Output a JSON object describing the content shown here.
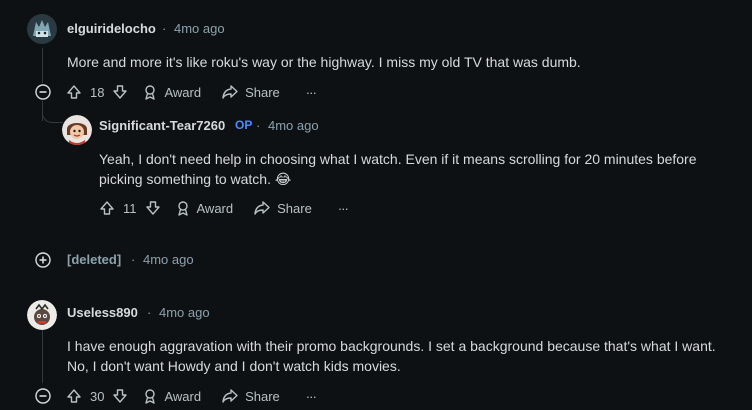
{
  "comments": [
    {
      "username": "elguiridelocho",
      "time": "4mo ago",
      "text": "More and more it's like roku's way or the highway. I miss my old TV that was dumb.",
      "votes": "18",
      "award": "Award",
      "share": "Share",
      "more": "···"
    },
    {
      "username": "Significant-Tear7260",
      "op": "OP",
      "time": "4mo ago",
      "text_line1": "Yeah, I don't need help in choosing what I watch. Even if it means scrolling for 20 minutes before",
      "text_line2": "picking something to watch.",
      "emoji": "😂",
      "votes": "11",
      "award": "Award",
      "share": "Share",
      "more": "···"
    },
    {
      "username": "[deleted]",
      "time": "4mo ago"
    },
    {
      "username": "Useless890",
      "time": "4mo ago",
      "text_line1": "I have enough aggravation with their promo backgrounds. I set a background because that's what I want.",
      "text_line2": "No, I don't want Howdy and I don't watch kids movies.",
      "votes": "30",
      "award": "Award",
      "share": "Share",
      "more": "···"
    }
  ],
  "separator": "·",
  "colors": {
    "background": "#0e1113",
    "op": "#4a8cff",
    "meta": "#8ba2ad"
  },
  "icons": [
    "collapse-icon",
    "expand-icon",
    "upvote-icon",
    "downvote-icon",
    "award-icon",
    "share-icon",
    "more-icon",
    "avatar"
  ]
}
